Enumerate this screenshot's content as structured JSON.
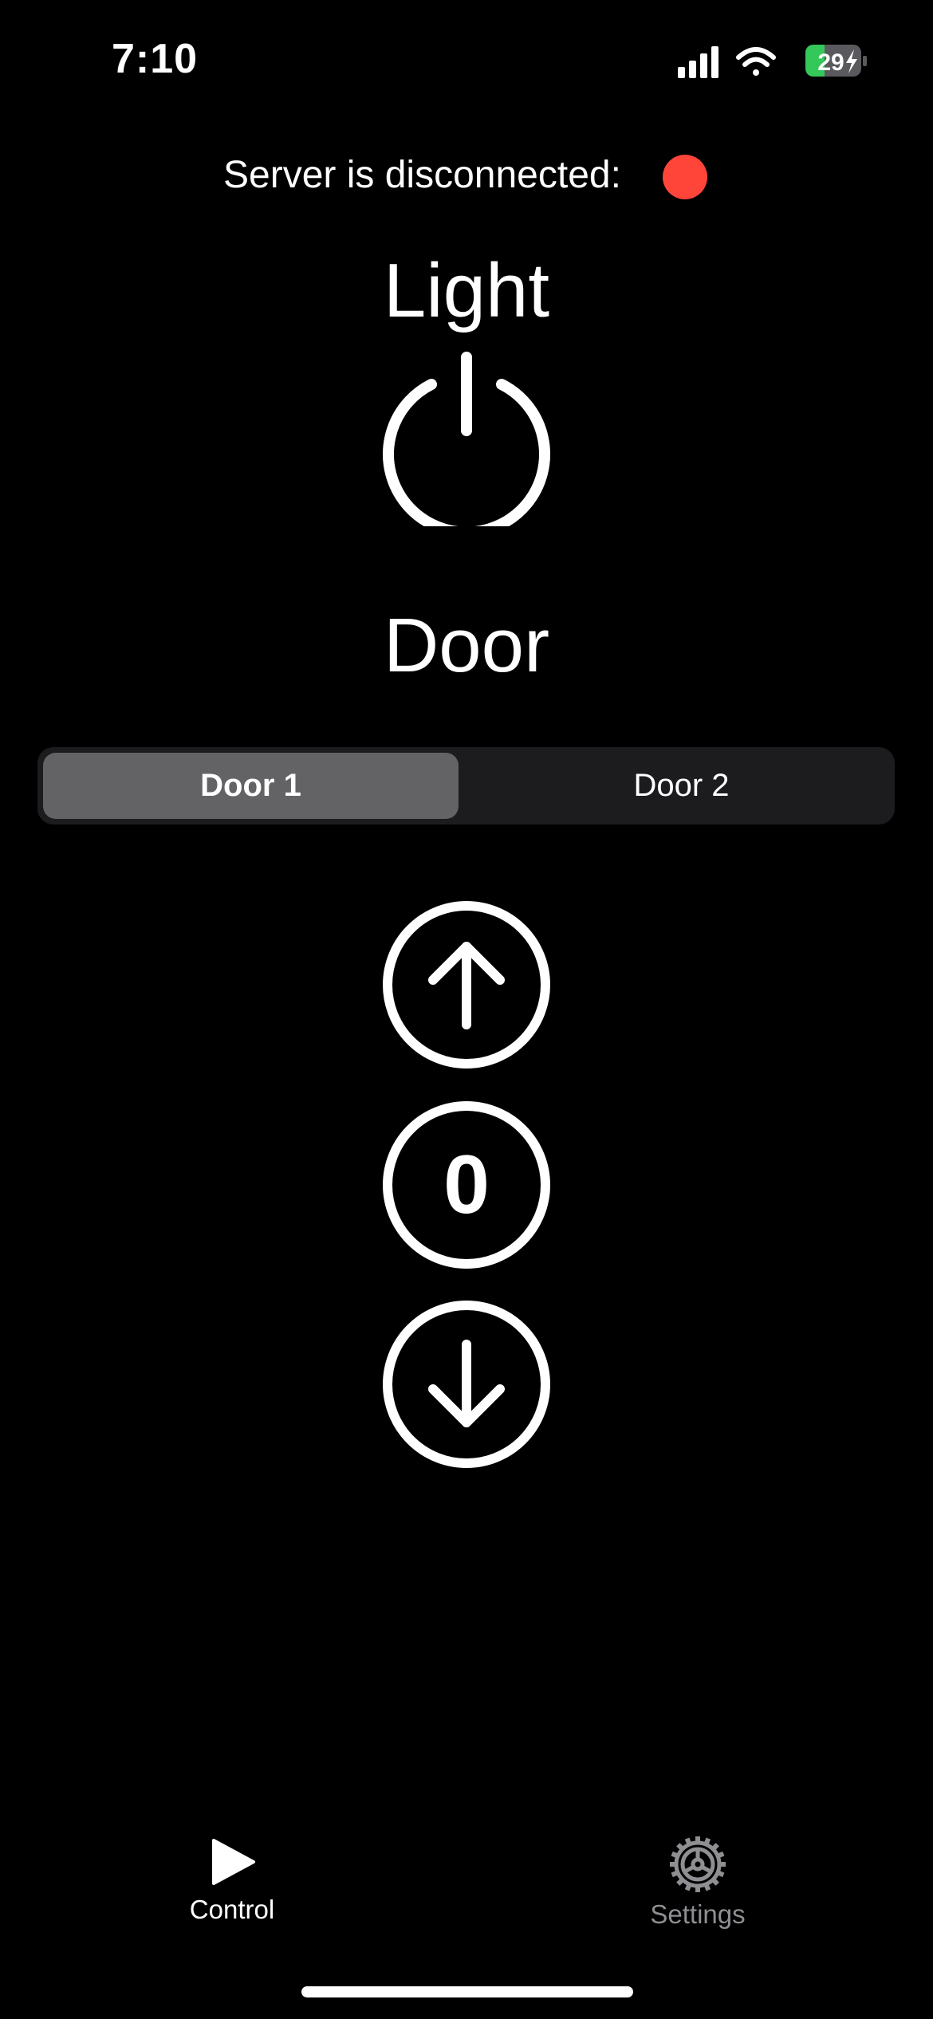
{
  "status_bar": {
    "time": "7:10",
    "battery": "29",
    "icons": [
      "cellular-signal-icon",
      "wifi-icon",
      "battery-charging-icon"
    ]
  },
  "server": {
    "label": "Server is disconnected:",
    "status_color": "#ff453a"
  },
  "light": {
    "title": "Light",
    "power_icon": "power-icon"
  },
  "door": {
    "title": "Door",
    "segments": [
      {
        "label": "Door 1",
        "selected": true
      },
      {
        "label": "Door 2",
        "selected": false
      }
    ],
    "controls": {
      "up_icon": "arrow-up-circle-icon",
      "stop_label": "0",
      "down_icon": "arrow-down-circle-icon"
    }
  },
  "tab_bar": {
    "tabs": [
      {
        "label": "Control",
        "icon": "play-icon",
        "active": true
      },
      {
        "label": "Settings",
        "icon": "gear-icon",
        "active": false
      }
    ]
  }
}
